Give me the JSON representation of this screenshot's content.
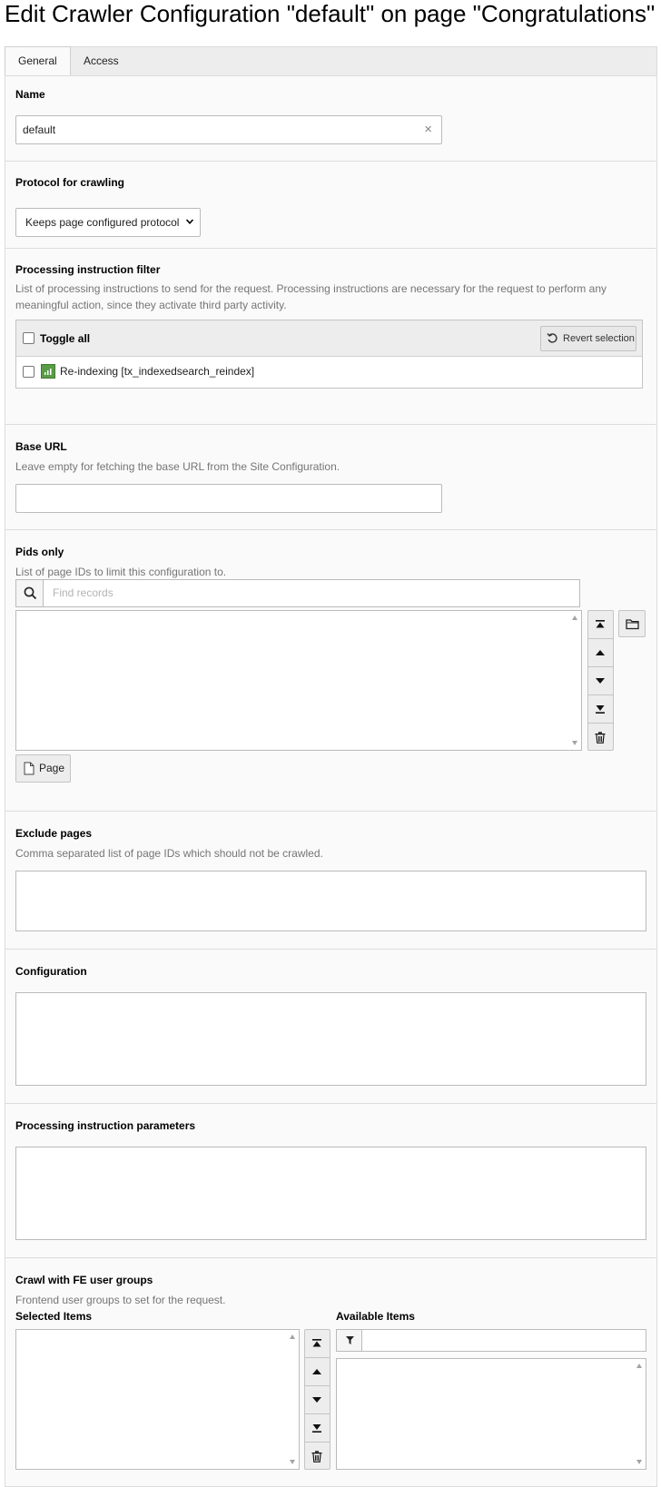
{
  "page": {
    "title": "Edit Crawler Configuration \"default\" on page \"Congratulations\""
  },
  "tabs": [
    {
      "label": "General",
      "active": true
    },
    {
      "label": "Access",
      "active": false
    }
  ],
  "fields": {
    "name": {
      "label": "Name",
      "value": "default",
      "clear_icon": "×"
    },
    "protocol": {
      "label": "Protocol for crawling",
      "selected": "Keeps page configured protocol"
    },
    "pi_filter": {
      "label": "Processing instruction filter",
      "description": "List of processing instructions to send for the request. Processing instructions are necessary for the request to perform any meaningful action, since they activate third party activity.",
      "toggle_all": "Toggle all",
      "revert_button": "Revert selection",
      "items": [
        {
          "label": "Re-indexing [tx_indexedsearch_reindex]",
          "checked": false
        }
      ]
    },
    "base_url": {
      "label": "Base URL",
      "description": "Leave empty for fetching the base URL from the Site Configuration.",
      "value": ""
    },
    "pids_only": {
      "label": "Pids only",
      "description": "List of page IDs to limit this configuration to.",
      "search_placeholder": "Find records",
      "page_button": "Page"
    },
    "exclude_pages": {
      "label": "Exclude pages",
      "description": "Comma separated list of page IDs which should not be crawled."
    },
    "configuration": {
      "label": "Configuration"
    },
    "pi_parameters": {
      "label": "Processing instruction parameters"
    },
    "fe_groups": {
      "label": "Crawl with FE user groups",
      "description": "Frontend user groups to set for the request.",
      "selected_label": "Selected Items",
      "available_label": "Available Items"
    }
  },
  "colors": {
    "accent_green": "#5a9c46",
    "panel_bg": "#fafafa",
    "border": "#bbbbbb"
  },
  "icons": {
    "search": "search-icon",
    "folder": "folder-icon",
    "page": "page-icon",
    "filter": "filter-icon",
    "revert": "revert-icon",
    "trash": "trash-icon"
  }
}
